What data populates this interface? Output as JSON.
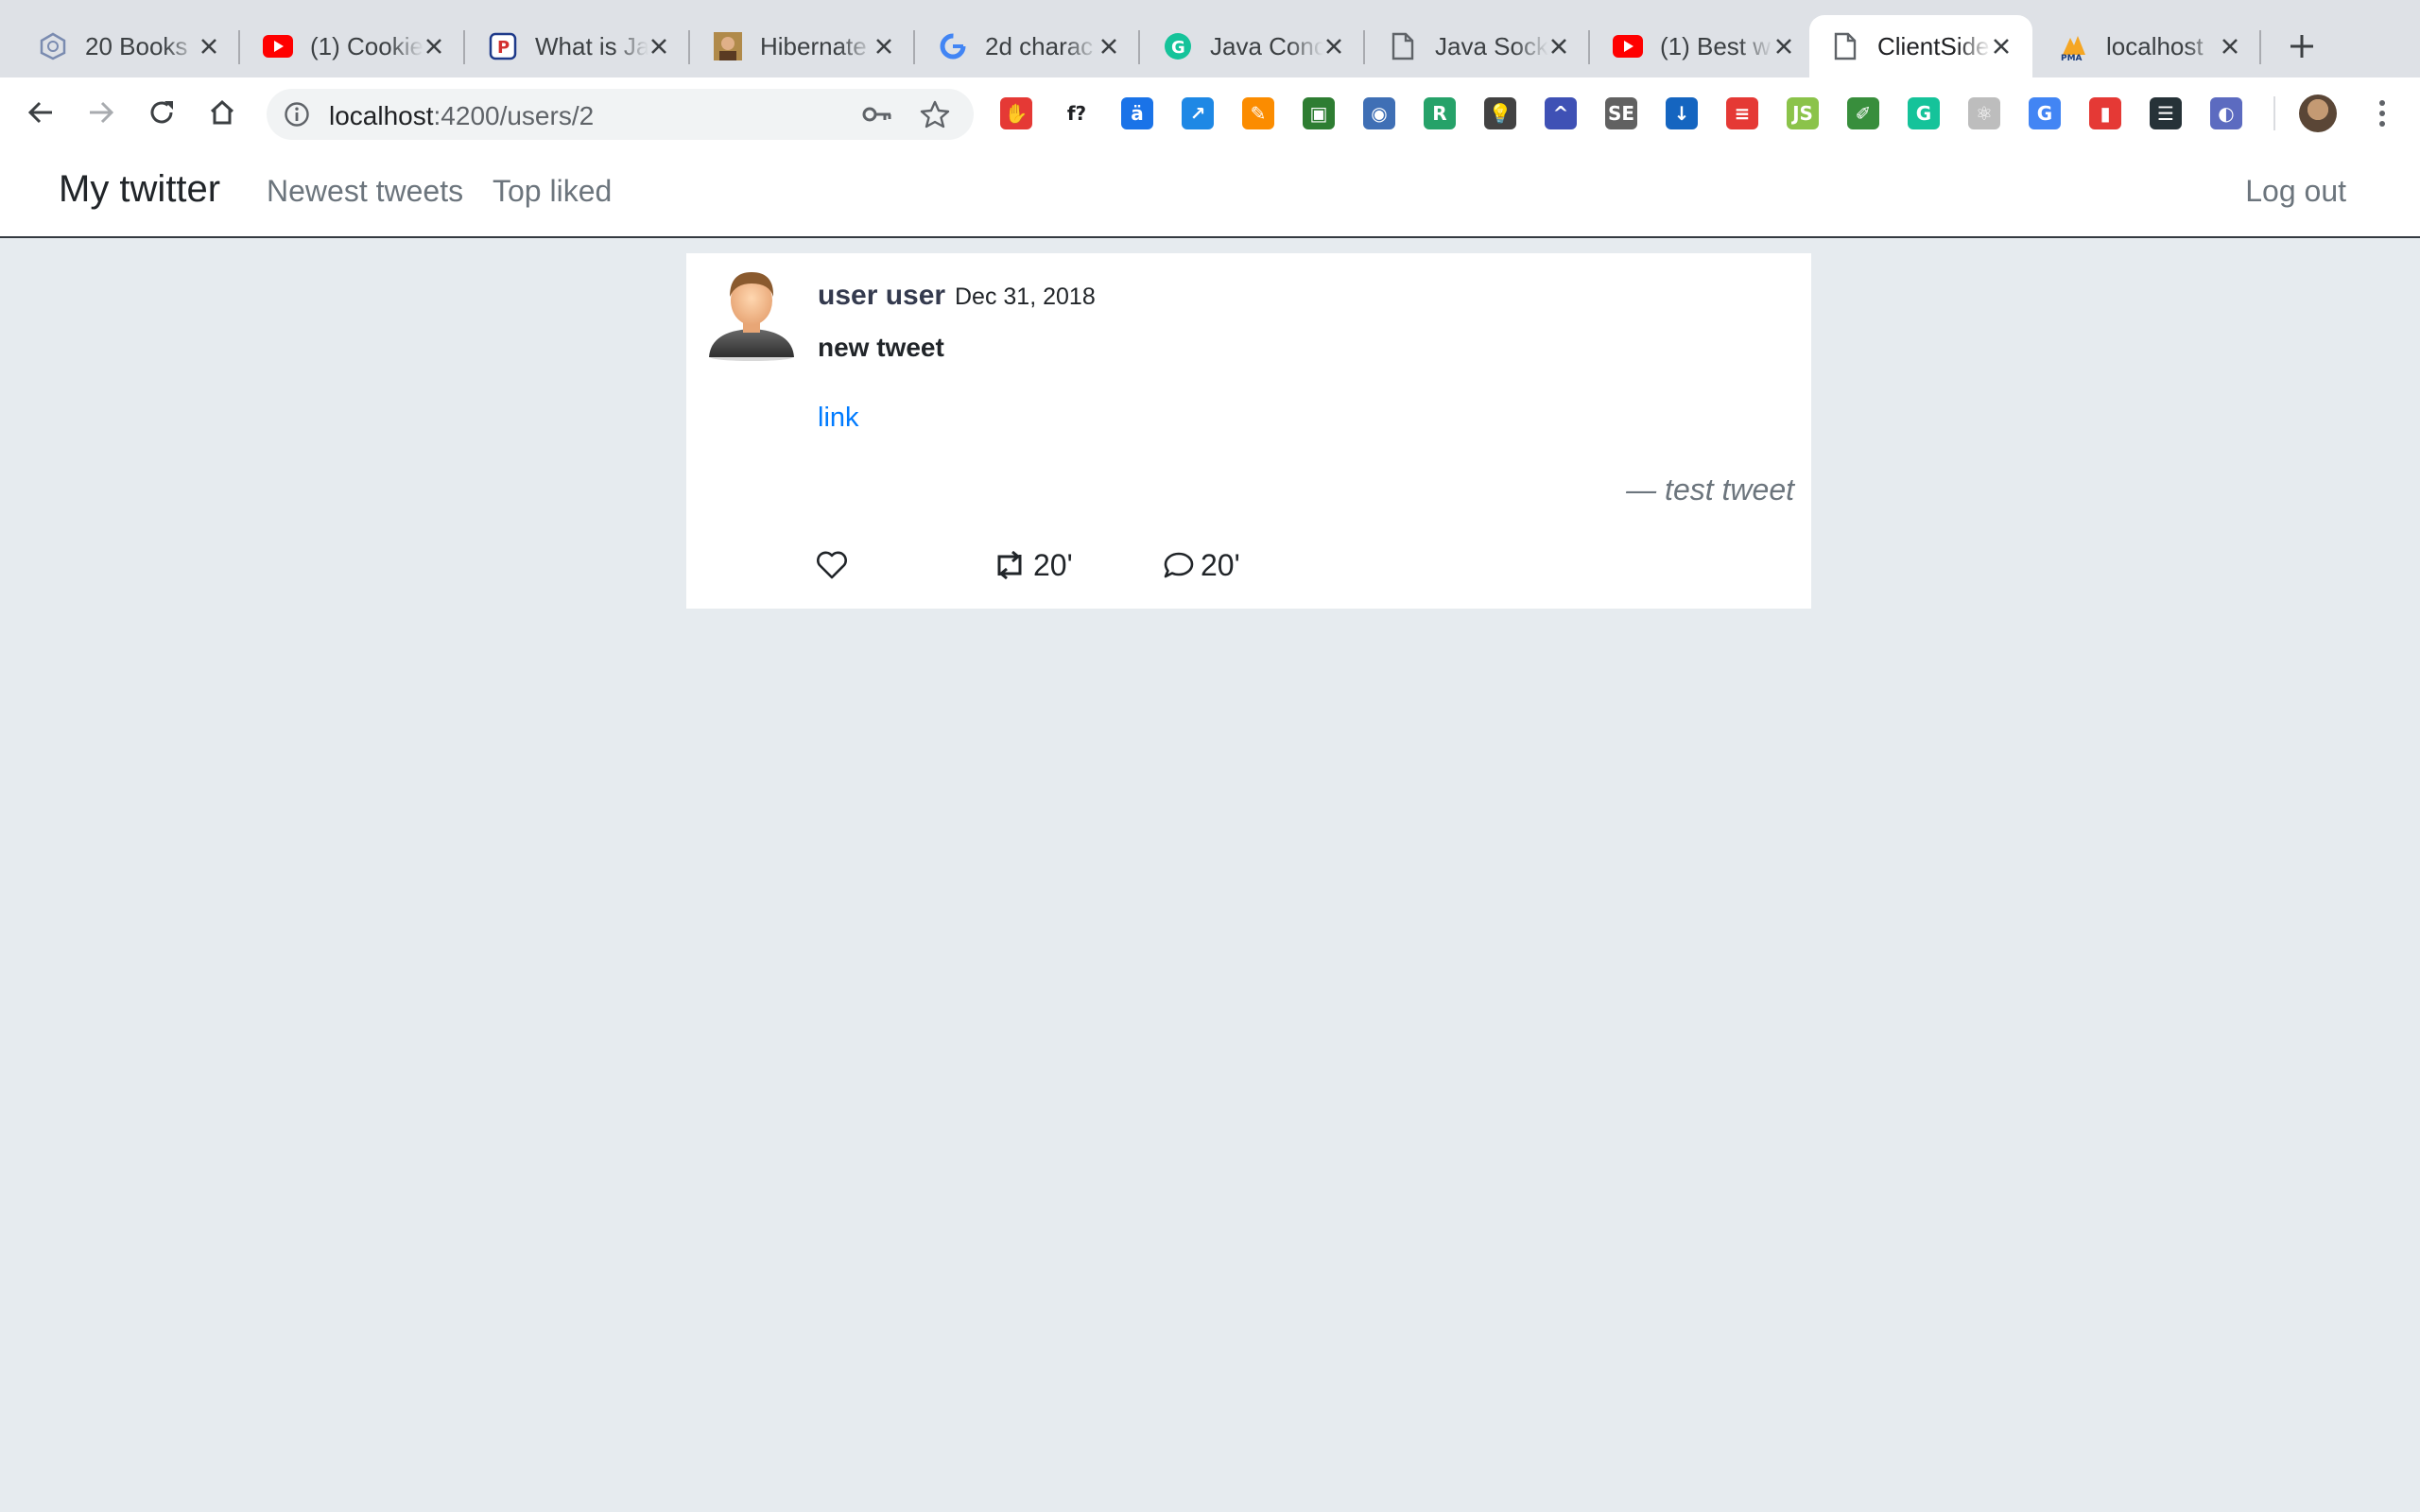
{
  "browser": {
    "tabs": [
      {
        "title": "20 Books",
        "icon": "book-stack-icon"
      },
      {
        "title": "(1) Cookie",
        "icon": "youtube-icon"
      },
      {
        "title": "What is Ja",
        "icon": "parking-icon"
      },
      {
        "title": "Hibernate",
        "icon": "person-photo-icon"
      },
      {
        "title": "2d charac",
        "icon": "google-icon"
      },
      {
        "title": "Java Conc",
        "icon": "grammarly-icon"
      },
      {
        "title": "Java Sock",
        "icon": "document-icon"
      },
      {
        "title": "(1) Best w",
        "icon": "youtube-icon"
      },
      {
        "title": "ClientSide",
        "icon": "document-icon"
      },
      {
        "title": "localhost",
        "icon": "phpmyadmin-icon"
      }
    ],
    "active_tab": 8,
    "url_host": "localhost",
    "url_path": ":4200/users/2",
    "extensions": [
      {
        "name": "adblock-icon",
        "color": "#e53935",
        "glyph": "✋"
      },
      {
        "name": "formula-icon",
        "color": "#ffffff",
        "glyph": "f?"
      },
      {
        "name": "ruler-icon",
        "color": "#1a73e8",
        "glyph": "ä"
      },
      {
        "name": "chart-icon",
        "color": "#1e88e5",
        "glyph": "↗"
      },
      {
        "name": "paint-icon",
        "color": "#fb8c00",
        "glyph": "✎"
      },
      {
        "name": "screenshot-icon",
        "color": "#2e7d32",
        "glyph": "▣"
      },
      {
        "name": "camera-icon",
        "color": "#3f6fb5",
        "glyph": "◉"
      },
      {
        "name": "r-icon",
        "color": "#26a269",
        "glyph": "R"
      },
      {
        "name": "bulb-icon",
        "color": "#424242",
        "glyph": "💡"
      },
      {
        "name": "caret-icon",
        "color": "#3f51b5",
        "glyph": "^"
      },
      {
        "name": "seo-icon",
        "color": "#616161",
        "glyph": "SE"
      },
      {
        "name": "png-icon",
        "color": "#1565c0",
        "glyph": "↓"
      },
      {
        "name": "todoist-icon",
        "color": "#e53935",
        "glyph": "≡"
      },
      {
        "name": "nodejs-icon",
        "color": "#8bc34a",
        "glyph": "JS"
      },
      {
        "name": "eyedropper-icon",
        "color": "#388e3c",
        "glyph": "✐"
      },
      {
        "name": "grammarly-ext-icon",
        "color": "#15c39a",
        "glyph": "G"
      },
      {
        "name": "react-icon",
        "color": "#bdbdbd",
        "glyph": "⚛"
      },
      {
        "name": "translate-icon",
        "color": "#4285f4",
        "glyph": "G"
      },
      {
        "name": "bars-icon",
        "color": "#e53935",
        "glyph": "▮"
      },
      {
        "name": "stack-icon",
        "color": "#263238",
        "glyph": "☰"
      },
      {
        "name": "lens-icon",
        "color": "#5c6bc0",
        "glyph": "◐"
      }
    ]
  },
  "app": {
    "brand": "My twitter",
    "nav": [
      "Newest tweets",
      "Top liked"
    ],
    "logout": "Log out"
  },
  "tweet": {
    "author": "user user",
    "date": "Dec 31, 2018",
    "text": "new tweet",
    "link": "link",
    "quote": "— test tweet",
    "retweets": "20'",
    "comments": "20'"
  }
}
